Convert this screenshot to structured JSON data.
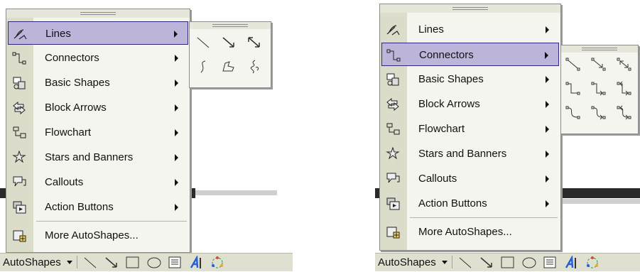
{
  "panels": [
    {
      "menu": {
        "items": [
          {
            "label": "Lines",
            "has_submenu": true,
            "selected": true,
            "icon": "lines-icon"
          },
          {
            "label": "Connectors",
            "has_submenu": true,
            "selected": false,
            "icon": "connectors-icon"
          },
          {
            "label": "Basic Shapes",
            "has_submenu": true,
            "selected": false,
            "icon": "basic-shapes-icon"
          },
          {
            "label": "Block Arrows",
            "has_submenu": true,
            "selected": false,
            "icon": "block-arrows-icon"
          },
          {
            "label": "Flowchart",
            "has_submenu": true,
            "selected": false,
            "icon": "flowchart-icon"
          },
          {
            "label": "Stars and Banners",
            "has_submenu": true,
            "selected": false,
            "icon": "stars-banners-icon"
          },
          {
            "label": "Callouts",
            "has_submenu": true,
            "selected": false,
            "icon": "callouts-icon"
          },
          {
            "label": "Action Buttons",
            "has_submenu": true,
            "selected": false,
            "icon": "action-buttons-icon"
          },
          {
            "label": "More AutoShapes...",
            "has_submenu": false,
            "selected": false,
            "icon": "more-autoshapes-icon"
          }
        ]
      },
      "submenu": {
        "name": "lines-submenu",
        "items": [
          "line-icon",
          "arrow-icon",
          "double-arrow-icon",
          "curve-icon",
          "freeform-icon",
          "scribble-icon"
        ]
      },
      "toolbar": {
        "label": "AutoShapes"
      }
    },
    {
      "menu": {
        "items": [
          {
            "label": "Lines",
            "has_submenu": true,
            "selected": false,
            "icon": "lines-icon"
          },
          {
            "label": "Connectors",
            "has_submenu": true,
            "selected": true,
            "icon": "connectors-icon"
          },
          {
            "label": "Basic Shapes",
            "has_submenu": true,
            "selected": false,
            "icon": "basic-shapes-icon"
          },
          {
            "label": "Block Arrows",
            "has_submenu": true,
            "selected": false,
            "icon": "block-arrows-icon"
          },
          {
            "label": "Flowchart",
            "has_submenu": true,
            "selected": false,
            "icon": "flowchart-icon"
          },
          {
            "label": "Stars and Banners",
            "has_submenu": true,
            "selected": false,
            "icon": "stars-banners-icon"
          },
          {
            "label": "Callouts",
            "has_submenu": true,
            "selected": false,
            "icon": "callouts-icon"
          },
          {
            "label": "Action Buttons",
            "has_submenu": true,
            "selected": false,
            "icon": "action-buttons-icon"
          },
          {
            "label": "More AutoShapes...",
            "has_submenu": false,
            "selected": false,
            "icon": "more-autoshapes-icon"
          }
        ]
      },
      "submenu": {
        "name": "connectors-submenu",
        "items": [
          "straight-connector-icon",
          "straight-arrow-connector-icon",
          "straight-double-arrow-connector-icon",
          "elbow-connector-icon",
          "elbow-arrow-connector-icon",
          "elbow-double-arrow-connector-icon",
          "curved-connector-icon",
          "curved-arrow-connector-icon",
          "curved-double-arrow-connector-icon"
        ]
      },
      "toolbar": {
        "label": "AutoShapes"
      }
    }
  ],
  "toolbar_icons": [
    "line-tool-icon",
    "arrow-tool-icon",
    "rectangle-tool-icon",
    "oval-tool-icon",
    "text-box-icon",
    "wordart-icon",
    "diagram-icon"
  ],
  "colors": {
    "menu_bg": "#f4f5ef",
    "highlight": "#bcb5d9",
    "highlight_border": "#2c2a78",
    "icon_strip": "#dcdccb"
  }
}
